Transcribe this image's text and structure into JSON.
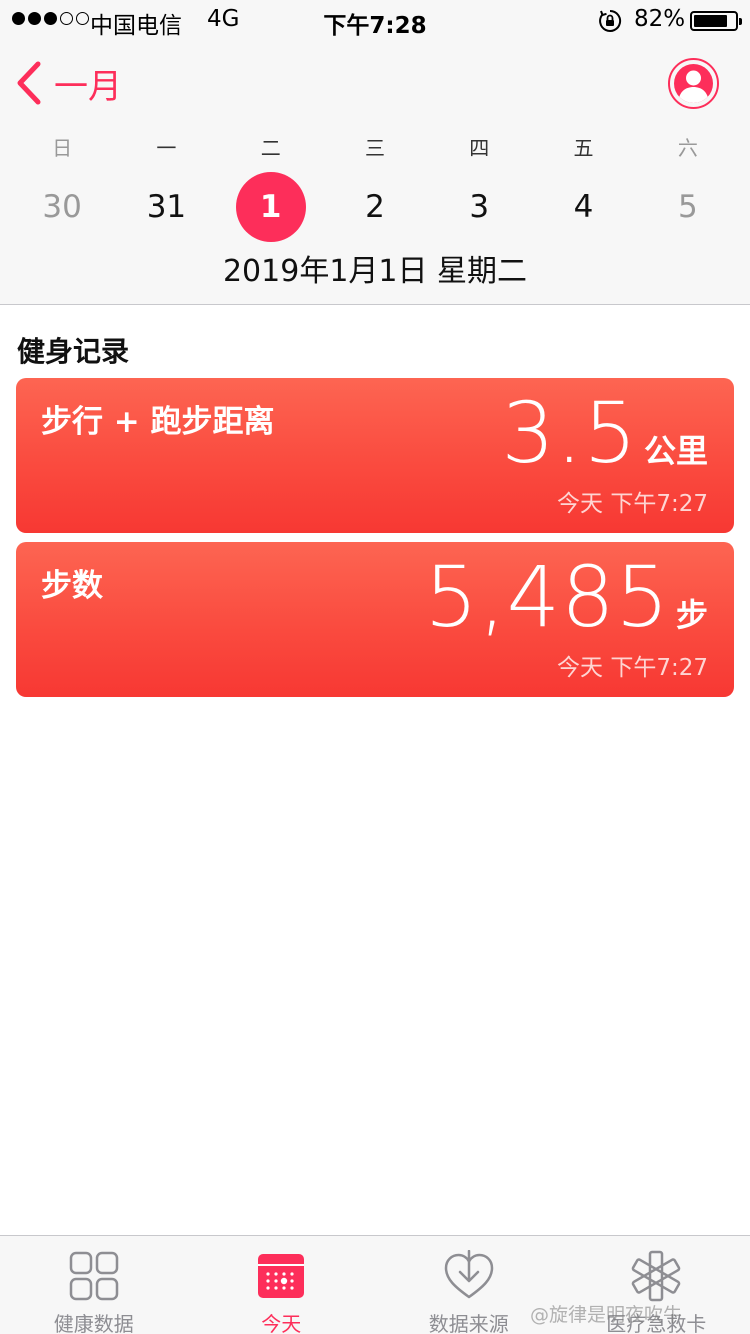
{
  "status_bar": {
    "signal_dots": [
      true,
      true,
      true,
      false,
      false
    ],
    "carrier": "中国电信",
    "network": "4G",
    "time": "下午7:28",
    "battery": "82%",
    "battery_level": 0.82
  },
  "nav": {
    "back_label": "一月",
    "accent_color": "#fd2e5a"
  },
  "week": {
    "weekdays": [
      "日",
      "一",
      "二",
      "三",
      "四",
      "五",
      "六"
    ],
    "dates": [
      "30",
      "31",
      "1",
      "2",
      "3",
      "4",
      "5"
    ],
    "selected_index": 2,
    "muted_indices": [
      0,
      6
    ],
    "full_date": "2019年1月1日 星期二"
  },
  "section_title": "健身记录",
  "cards": [
    {
      "title": "步行 + 跑步距离",
      "value": "3.5",
      "unit": "公里",
      "time": "今天 下午7:27"
    },
    {
      "title": "步数",
      "value": "5,485",
      "unit": "步",
      "time": "今天 下午7:27"
    }
  ],
  "tabs": [
    {
      "label": "健康数据",
      "icon": "health-data-grid-icon",
      "active": false
    },
    {
      "label": "今天",
      "icon": "calendar-today-icon",
      "active": true
    },
    {
      "label": "数据来源",
      "icon": "heart-download-icon",
      "active": false
    },
    {
      "label": "医疗急救卡",
      "icon": "medical-asterisk-icon",
      "active": false
    }
  ],
  "watermark": "@旋律是明夜吹牛"
}
